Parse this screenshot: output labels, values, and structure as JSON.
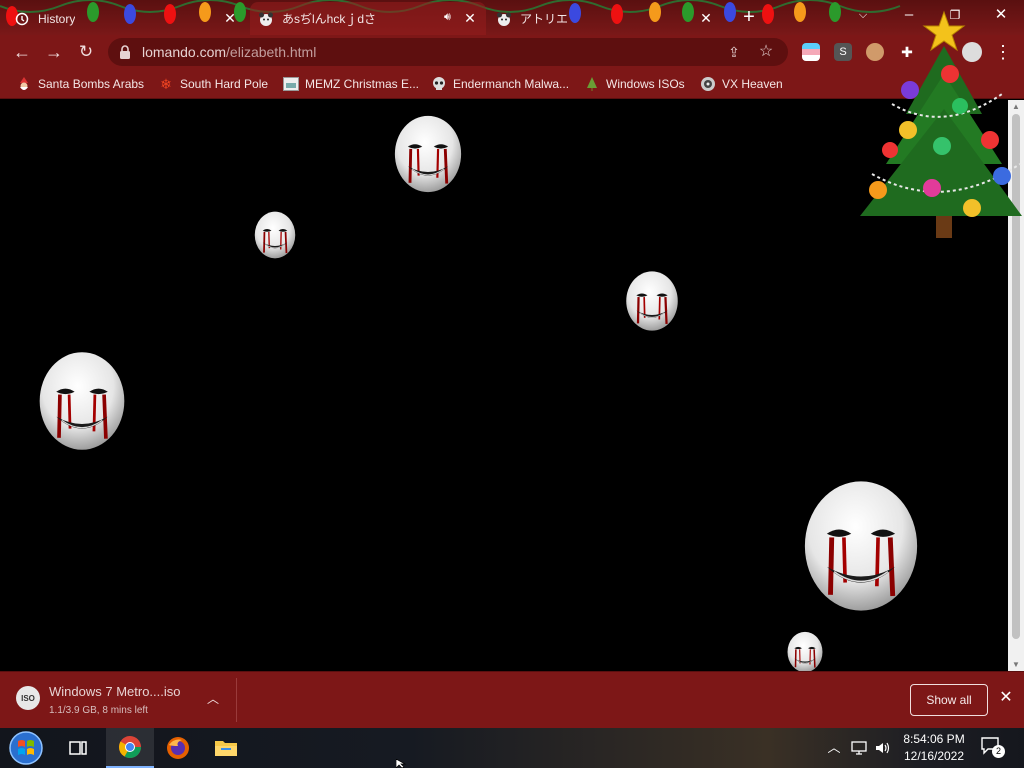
{
  "browser": {
    "tabs": [
      {
        "title": "History",
        "icon": "history-icon",
        "active": false
      },
      {
        "title": "あsぢlんhckｊdさ",
        "icon": "bear-favicon",
        "active": true,
        "audio": true
      },
      {
        "title": "アトリエ",
        "icon": "bear-favicon",
        "active": false
      }
    ],
    "address_host": "lomando.com",
    "address_path": "/elizabeth.html",
    "extensions": [
      "trans-flag-extension",
      "s-extension",
      "avatar-extension",
      "extensions-puzzle-icon",
      "profile-icon"
    ],
    "accent_color": "#7d1717"
  },
  "bookmarks": [
    {
      "label": "Santa Bombs Arabs",
      "icon": "santa-icon"
    },
    {
      "label": "South Hard Pole",
      "icon": "red-snowflake-icon"
    },
    {
      "label": "MEMZ Christmas E...",
      "icon": "memz-icon"
    },
    {
      "label": "Endermanch Malwa...",
      "icon": "skull-icon"
    },
    {
      "label": "Windows ISOs",
      "icon": "tree-icon"
    },
    {
      "label": "VX Heaven",
      "icon": "vx-icon"
    }
  ],
  "download": {
    "file_name": "Windows 7 Metro....iso",
    "status": "1.1/3.9 GB, 8 mins left",
    "show_all_label": "Show all",
    "icon_label": "ISO"
  },
  "taskbar": {
    "apps": [
      "task-view-icon",
      "chrome-icon",
      "firefox-icon",
      "file-explorer-icon"
    ],
    "time": "8:54:06 PM",
    "date": "12/16/2022",
    "notification_count": "2"
  }
}
